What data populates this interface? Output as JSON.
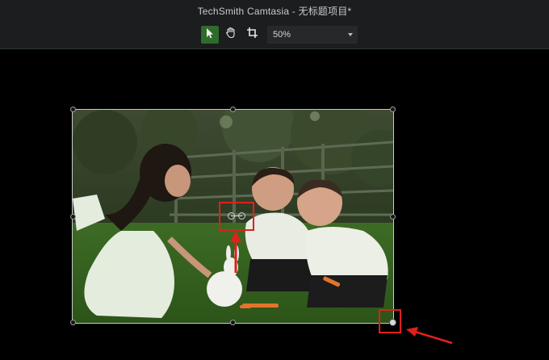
{
  "window": {
    "title": "TechSmith Camtasia - 无标题项目*"
  },
  "toolbar": {
    "tools": [
      {
        "icon": "arrow-pointer-icon",
        "active": true
      },
      {
        "icon": "hand-pan-icon",
        "active": false
      },
      {
        "icon": "crop-icon",
        "active": false
      }
    ],
    "zoom": {
      "value": "50%"
    }
  },
  "colors": {
    "accent": "#2f6b2a",
    "annotation": "#e0201a",
    "background": "#000000",
    "toolbar": "#1b1d1f"
  }
}
